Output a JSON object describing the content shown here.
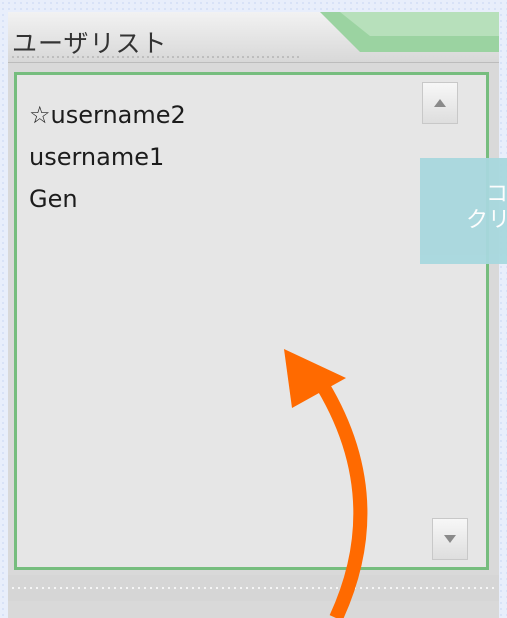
{
  "panel": {
    "title": "ユーザリスト"
  },
  "user_list": {
    "items": [
      {
        "label": "☆username2"
      },
      {
        "label": "username1"
      },
      {
        "label": "Gen"
      }
    ]
  },
  "tooltip": {
    "lines": [
      "コ",
      "クリ"
    ]
  },
  "icons": {
    "scroll_up": "triangle-up",
    "scroll_down": "triangle-down",
    "annotation_arrow": "curved-arrow-up"
  },
  "colors": {
    "list_border": "#76bd7e",
    "header_accent": "#8fcf96",
    "tooltip_bg": "#a8d8de",
    "arrow": "#ff6a00"
  }
}
